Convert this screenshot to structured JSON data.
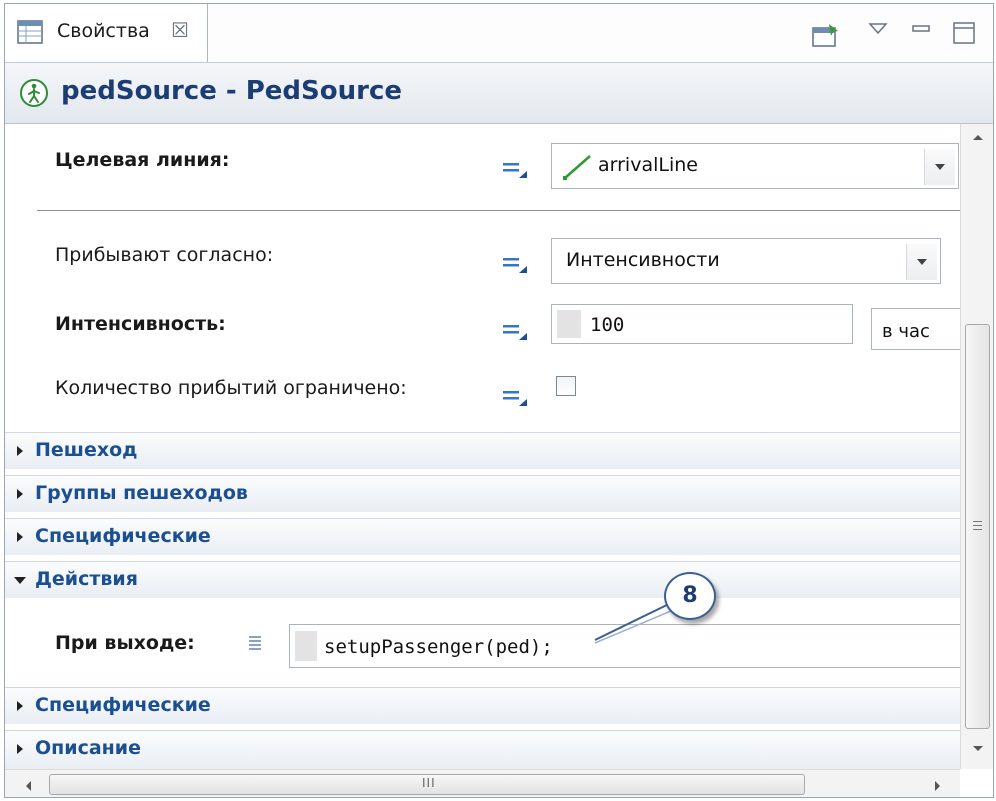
{
  "tab": {
    "label": "Свойства",
    "close_glyph": "☒"
  },
  "header": {
    "title": "pedSource - PedSource"
  },
  "properties": {
    "target_line": {
      "label": "Целевая линия:",
      "value": "arrivalLine"
    },
    "arrive_according": {
      "label": "Прибывают согласно:",
      "value": "Интенсивности"
    },
    "rate": {
      "label": "Интенсивность:",
      "value": "100",
      "unit": "в час"
    },
    "limited_arrivals": {
      "label": "Количество прибытий ограничено:",
      "checked": false
    }
  },
  "sections": {
    "pedestrian": "Пешеход",
    "pedestrian_groups": "Группы пешеходов",
    "specific1": "Специфические",
    "actions": "Действия",
    "specific2": "Специфические",
    "description": "Описание"
  },
  "actions": {
    "on_exit_label": "При выходе:",
    "on_exit_code": "setupPassenger(ped);"
  },
  "callout": {
    "number": "8"
  },
  "scrollbar": {
    "h_grip": "III"
  },
  "icons": {
    "tab": "properties-table-icon",
    "pin": "pin-icon",
    "view_menu": "view-menu-icon",
    "minimize": "minimize-icon",
    "maximize": "maximize-icon",
    "pedestrian": "pedestrian-icon"
  },
  "colors": {
    "section_text": "#1b4f8f",
    "title_text": "#1b3d73",
    "eq_icon": "#3576c8"
  }
}
